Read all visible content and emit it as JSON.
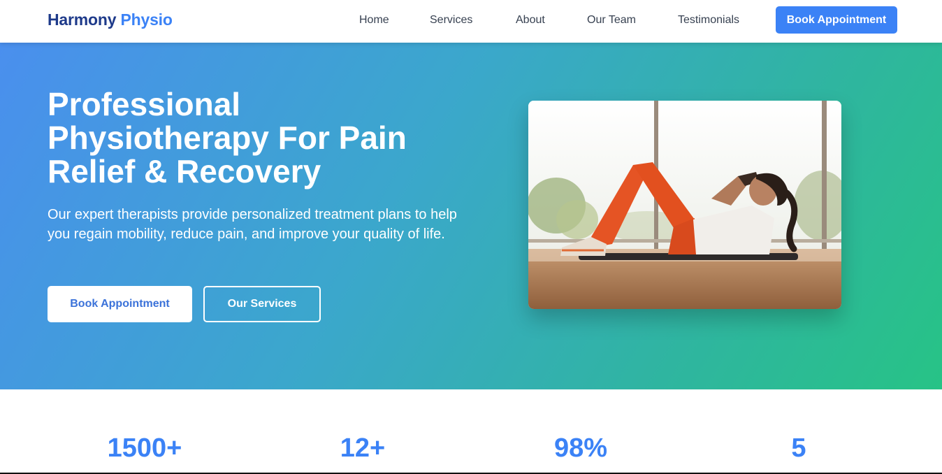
{
  "header": {
    "logo_part1": "Harmony",
    "logo_part2": "Physio",
    "nav": [
      "Home",
      "Services",
      "About",
      "Our Team",
      "Testimonials"
    ],
    "cta_label": "Book Appointment"
  },
  "hero": {
    "title": "Professional Physiotherapy For Pain Relief & Recovery",
    "subtitle": "Our expert therapists provide personalized treatment plans to help you regain mobility, reduce pain, and improve your quality of life.",
    "primary_button": "Book Appointment",
    "secondary_button": "Our Services"
  },
  "stats": [
    {
      "value": "1500+"
    },
    {
      "value": "12+"
    },
    {
      "value": "98%"
    },
    {
      "value": "5"
    }
  ],
  "colors": {
    "brand_dark": "#1e3a8a",
    "brand_accent": "#3b82f6",
    "hero_gradient_start": "#4a8fee",
    "hero_gradient_end": "#27c386"
  }
}
